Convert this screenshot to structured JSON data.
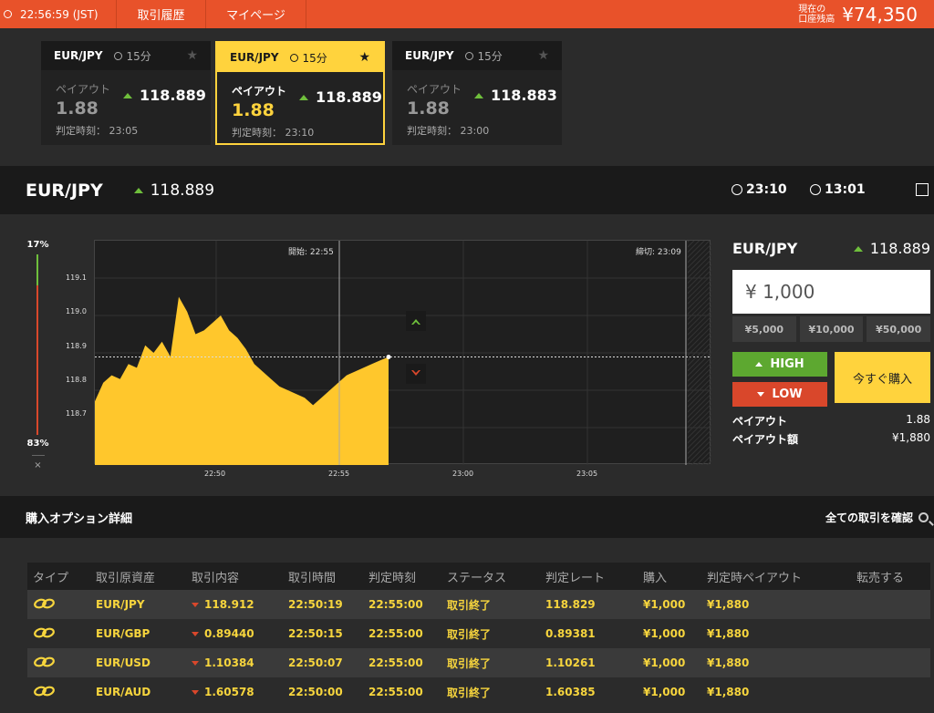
{
  "topbar": {
    "time": "22:56:59 (JST)",
    "nav1": "取引履歴",
    "nav2": "マイページ",
    "balance_label_1": "現在の",
    "balance_label_2": "口座残高",
    "balance": "¥74,350"
  },
  "cards": [
    {
      "pair": "EUR/JPY",
      "duration": "15分",
      "payout_label": "ペイアウト",
      "payout": "1.88",
      "price": "118.889",
      "judge": "判定時刻： 23:05"
    },
    {
      "pair": "EUR/JPY",
      "duration": "15分",
      "payout_label": "ペイアウト",
      "payout": "1.88",
      "price": "118.889",
      "judge": "判定時刻： 23:10"
    },
    {
      "pair": "EUR/JPY",
      "duration": "15分",
      "payout_label": "ペイアウト",
      "payout": "1.88",
      "price": "118.883",
      "judge": "判定時刻： 23:00"
    }
  ],
  "pairbar": {
    "pair": "EUR/JPY",
    "price": "118.889",
    "close_time": "23:10",
    "remaining": "13:01"
  },
  "gauge": {
    "high_pct": "17%",
    "low_pct": "83%",
    "close": "×",
    "high_fraction": 0.17
  },
  "chart_data": {
    "type": "area",
    "yticks": [
      "119.1",
      "119.0",
      "118.9",
      "118.8",
      "118.7"
    ],
    "xticks": [
      "22:50",
      "22:55",
      "23:00",
      "23:05"
    ],
    "start_label": "開始: 22:55",
    "end_label": "締切: 23:09",
    "current_rate": 118.889,
    "series": [
      {
        "values": [
          118.77,
          118.82,
          118.84,
          118.83,
          118.87,
          118.86,
          118.92,
          118.9,
          118.93,
          118.89,
          119.05,
          119.01,
          118.95,
          118.96,
          118.98,
          119.0,
          118.96,
          118.94,
          118.91,
          118.87,
          118.85,
          118.83,
          118.81,
          118.8,
          118.79,
          118.78,
          118.76,
          118.78,
          118.8,
          118.82,
          118.84,
          118.85,
          118.86,
          118.87,
          118.88,
          118.889
        ]
      }
    ]
  },
  "side": {
    "pair": "EUR/JPY",
    "price": "118.889",
    "amount": "¥ 1,000",
    "presets": [
      "¥5,000",
      "¥10,000",
      "¥50,000"
    ],
    "high": "HIGH",
    "low": "LOW",
    "buy": "今すぐ購入",
    "payout_label": "ペイアウト",
    "payout": "1.88",
    "payout_amt_label": "ペイアウト額",
    "payout_amt": "¥1,880"
  },
  "detail": {
    "title": "購入オプション詳細",
    "all": "全ての取引を確認"
  },
  "table": {
    "headers": [
      "タイプ",
      "取引原資産",
      "取引内容",
      "取引時間",
      "判定時刻",
      "ステータス",
      "判定レート",
      "購入",
      "判定時ペイアウト",
      "転売する"
    ],
    "rows": [
      {
        "asset": "EUR/JPY",
        "rate": "118.912",
        "time": "22:50:19",
        "judge": "22:55:00",
        "status": "取引終了",
        "jrate": "118.829",
        "buy": "¥1,000",
        "payout": "¥1,880"
      },
      {
        "asset": "EUR/GBP",
        "rate": "0.89440",
        "time": "22:50:15",
        "judge": "22:55:00",
        "status": "取引終了",
        "jrate": "0.89381",
        "buy": "¥1,000",
        "payout": "¥1,880"
      },
      {
        "asset": "EUR/USD",
        "rate": "1.10384",
        "time": "22:50:07",
        "judge": "22:55:00",
        "status": "取引終了",
        "jrate": "1.10261",
        "buy": "¥1,000",
        "payout": "¥1,880"
      },
      {
        "asset": "EUR/AUD",
        "rate": "1.60578",
        "time": "22:50:00",
        "judge": "22:55:00",
        "status": "取引終了",
        "jrate": "1.60385",
        "buy": "¥1,000",
        "payout": "¥1,880"
      }
    ]
  }
}
